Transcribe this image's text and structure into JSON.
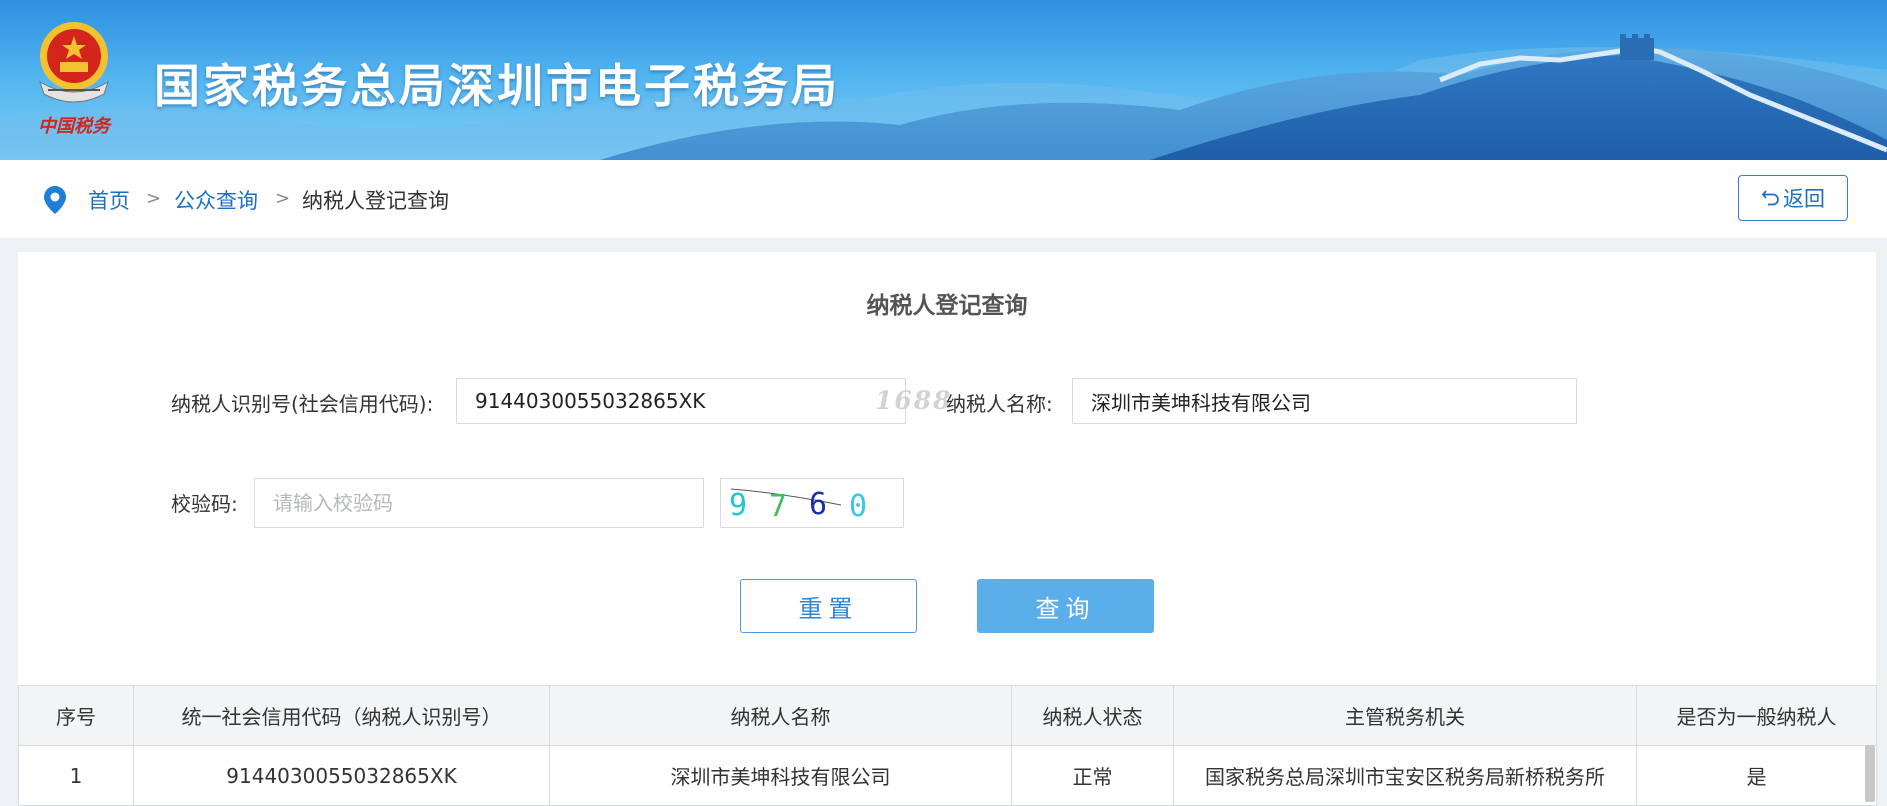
{
  "header": {
    "site_title": "国家税务总局深圳市电子税务局",
    "emblem_caption": "中国税务"
  },
  "breadcrumb": {
    "items": [
      "首页",
      "公众查询",
      "纳税人登记查询"
    ],
    "separator": ">"
  },
  "back_button": {
    "icon": "undo-arrow-icon",
    "label": "返回"
  },
  "form": {
    "title": "纳税人登记查询",
    "taxpayer_id_label": "纳税人识别号(社会信用代码):",
    "taxpayer_id_value": "9144030055032865XK",
    "taxpayer_name_label": "纳税人名称:",
    "taxpayer_name_value": "深圳市美坤科技有限公司",
    "captcha_label": "校验码:",
    "captcha_placeholder": "请输入校验码",
    "captcha_chars": [
      "9",
      "7",
      "6",
      "0"
    ],
    "captcha_colors": [
      "#27c3d9",
      "#3fbf5a",
      "#1b2fa8",
      "#39c7e0"
    ],
    "watermark": "1688",
    "reset_label": "重置",
    "query_label": "查询"
  },
  "table": {
    "headers": [
      "序号",
      "统一社会信用代码（纳税人识别号）",
      "纳税人名称",
      "纳税人状态",
      "主管税务机关",
      "是否为一般纳税人"
    ],
    "rows": [
      [
        "1",
        "9144030055032865XK",
        "深圳市美坤科技有限公司",
        "正常",
        "国家税务总局深圳市宝安区税务局新桥税务所",
        "是"
      ]
    ]
  },
  "colors": {
    "primary": "#2f86d8",
    "query_button": "#5aaeea",
    "banner_top": "#2f8fe0",
    "emblem_red": "#d4251c",
    "emblem_gold": "#f2c230"
  }
}
